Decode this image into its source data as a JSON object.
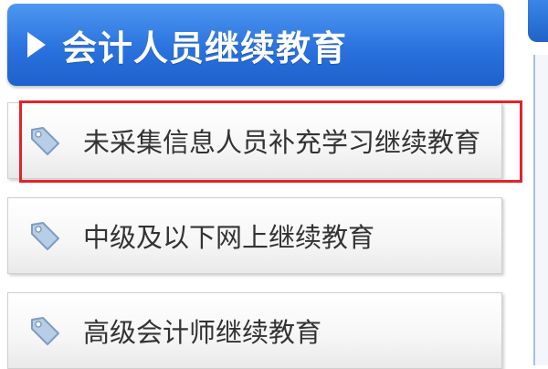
{
  "header": {
    "title": "会计人员继续教育"
  },
  "menu": {
    "items": [
      {
        "label": "未采集信息人员补充学习继续教育",
        "icon": "tag-icon"
      },
      {
        "label": "中级及以下网上继续教育",
        "icon": "tag-icon"
      },
      {
        "label": "高级会计师继续教育",
        "icon": "tag-icon"
      }
    ]
  },
  "colors": {
    "header": "#2a72de",
    "highlight": "#e2232a",
    "tag": "#8fb0d6"
  }
}
